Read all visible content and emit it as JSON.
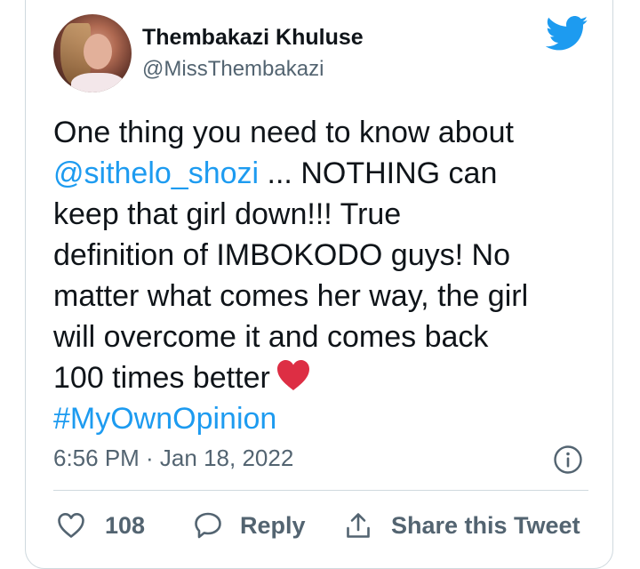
{
  "author": {
    "display_name": "Thembakazi Khuluse",
    "handle": "@MissThembakazi"
  },
  "tweet": {
    "lines": [
      "One thing you need to know about",
      "... NOTHING can",
      "keep that girl down!!! True",
      "definition of IMBOKODO guys! No",
      "matter what comes her way, the girl",
      "will overcome it and comes back",
      "100 times better"
    ],
    "mention": "@sithelo_shozi",
    "hashtag": "#MyOwnOpinion",
    "emoji": "red-heart-icon"
  },
  "timestamp": "6:56 PM · Jan 18, 2022",
  "actions": {
    "like_count": "108",
    "reply_label": "Reply",
    "share_label": "Share this Tweet"
  },
  "colors": {
    "link": "#1d9bf0",
    "twitter_blue": "#1d9bf0",
    "heart_red": "#dd2e44",
    "secondary_text": "#536471",
    "border": "#cfd9de"
  },
  "icons": [
    "twitter-bird-icon",
    "info-icon",
    "heart-outline-icon",
    "reply-bubble-icon",
    "share-icon"
  ]
}
